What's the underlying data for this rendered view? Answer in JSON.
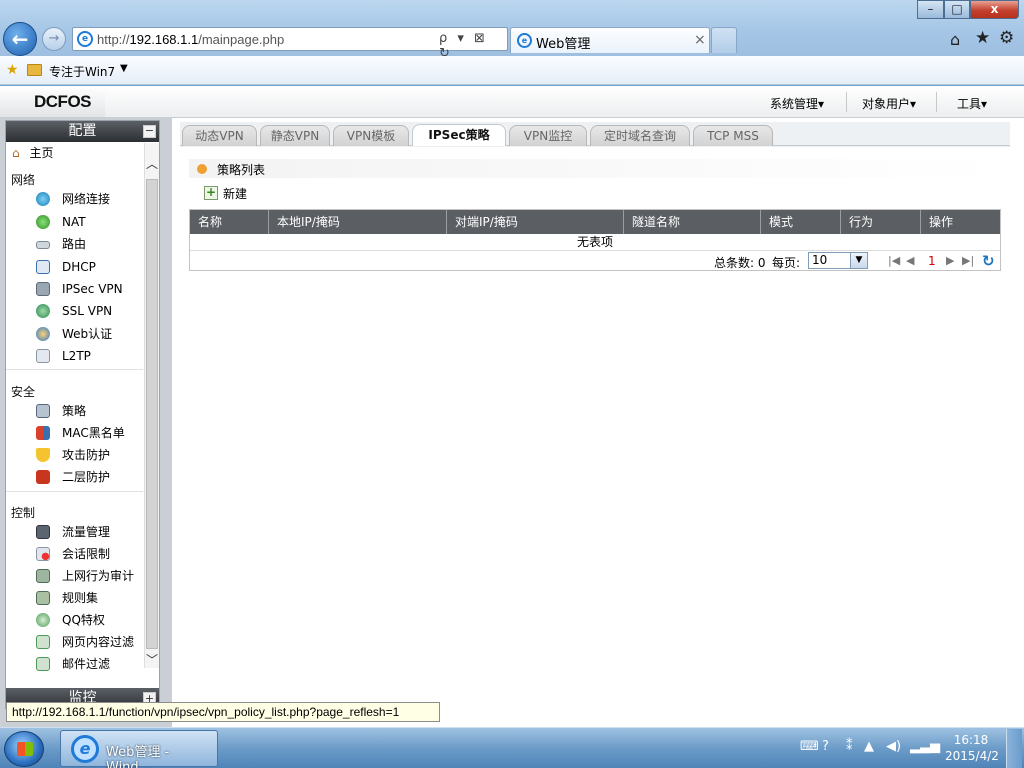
{
  "browser": {
    "address_scheme": "http://",
    "address_host": "192.168.1.1",
    "address_path": "/mainpage.php",
    "address_tools": "ρ ▾ ⊠ ↻",
    "tab_title": "Web管理",
    "tab_close": "×",
    "back_glyph": "←",
    "forward_glyph": "→",
    "window_min": "–",
    "window_max": "□",
    "window_close": "x"
  },
  "favorites": {
    "item_label": "专注于Win7"
  },
  "app": {
    "logo": "DCFOS",
    "menus": [
      "系统管理▾",
      "对象用户▾",
      "工具▾"
    ]
  },
  "sidebar": {
    "header": "配置",
    "collapse": "−",
    "home": "主页",
    "groups": [
      {
        "title": "网络",
        "items": [
          "网络连接",
          "NAT",
          "路由",
          "DHCP",
          "IPSec VPN",
          "SSL VPN",
          "Web认证",
          "L2TP"
        ]
      },
      {
        "title": "安全",
        "items": [
          "策略",
          "MAC黑名单",
          "攻击防护",
          "二层防护"
        ]
      },
      {
        "title": "控制",
        "items": [
          "流量管理",
          "会话限制",
          "上网行为审计",
          "规则集",
          "QQ特权",
          "网页内容过滤",
          "邮件过滤"
        ]
      }
    ],
    "footer": "监控",
    "expand": "+"
  },
  "tabs": [
    "动态VPN",
    "静态VPN",
    "VPN模板",
    "IPSec策略",
    "VPN监控",
    "定时域名查询",
    "TCP MSS"
  ],
  "active_tab": "IPSec策略",
  "policy_list": {
    "title": "策略列表",
    "new_label": "新建",
    "columns": [
      "名称",
      "本地IP/掩码",
      "对端IP/掩码",
      "隧道名称",
      "模式",
      "行为",
      "操作"
    ],
    "empty_text": "无表项",
    "total_label": "总条数: 0",
    "per_page_label": "每页:",
    "per_page_value": "10",
    "page": "1"
  },
  "status_url": "http://192.168.1.1/function/vpn/ipsec/vpn_policy_list.php?page_reflesh=1",
  "taskbar": {
    "task_label": "Web管理 - Wind...",
    "time": "16:18",
    "date": "2015/4/2"
  },
  "colors": {
    "sidebar_header": "#2b2e32",
    "grid_header": "#5b5e63",
    "accent_dot": "#f0a030",
    "page_number": "#d10000"
  }
}
